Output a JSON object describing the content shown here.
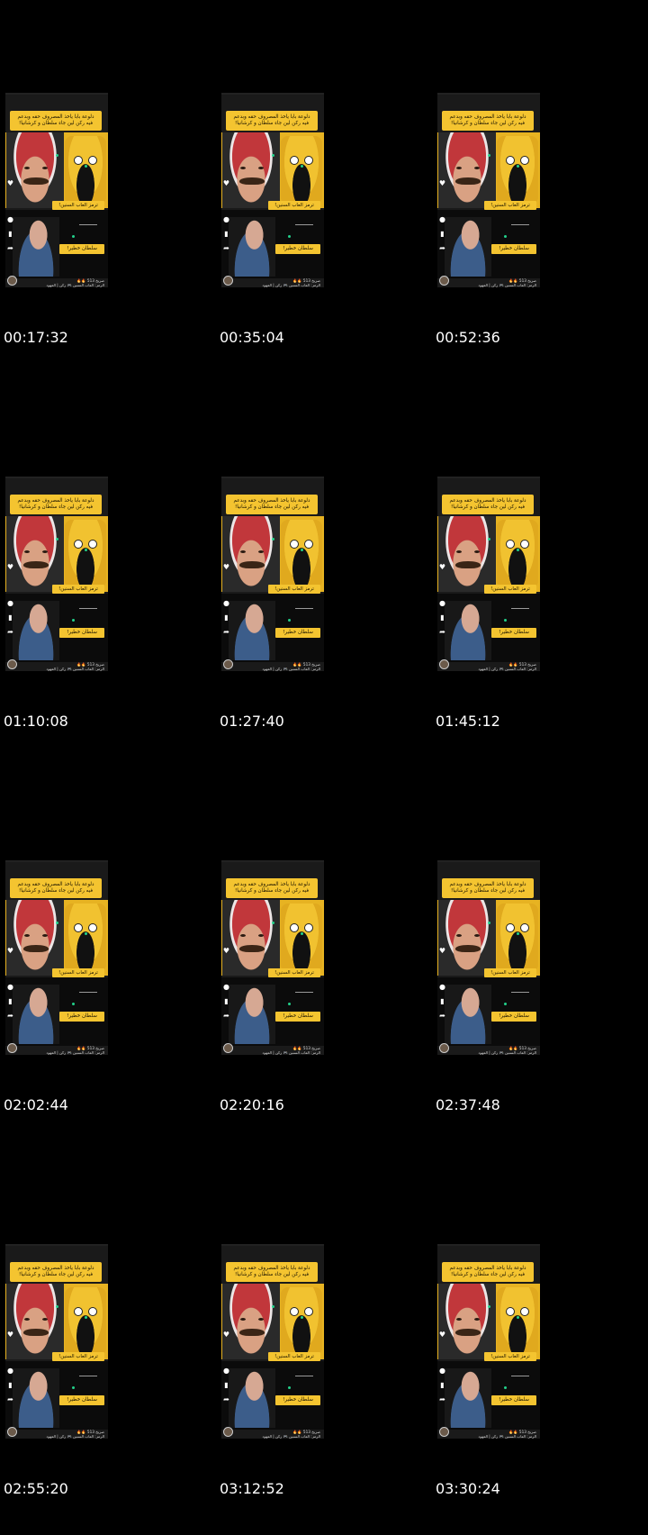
{
  "overlay": {
    "banner_line_1": "دلوعة بابا ياخذ المصروف حقه وبدعم",
    "banner_line_2": "فيه ركن لين جاء سلطان و كرشانيا!",
    "label_mid": "ترمز العاب السنين!",
    "label_low": "سلطان خطير!",
    "bottom_row_1": "صريخ 513 🔥🔥",
    "bottom_row_2": "الرمز: العاب السنين 🎮 ركن | العهود"
  },
  "timestamps": [
    "00:17:32",
    "00:35:04",
    "00:52:36",
    "01:10:08",
    "01:27:40",
    "01:45:12",
    "02:02:44",
    "02:20:16",
    "02:37:48",
    "02:55:20",
    "03:12:52",
    "03:30:24"
  ],
  "colors": {
    "background": "#000000",
    "banner": "#f4c430",
    "timestamp": "#ffffff",
    "accent_green": "#22d18b"
  },
  "icons": [
    "heart-icon",
    "comment-icon",
    "bookmark-icon",
    "share-icon"
  ]
}
